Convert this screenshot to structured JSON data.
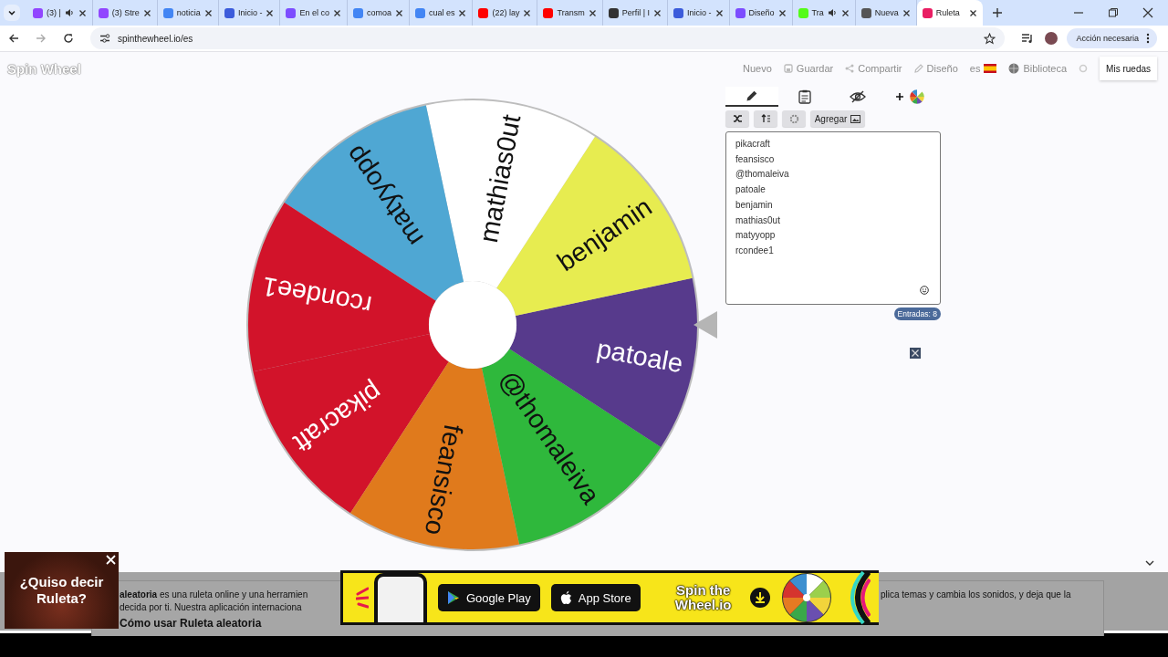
{
  "browser": {
    "tabs": [
      {
        "title": "(3) |",
        "color": "#9146ff",
        "audio": true,
        "selected": false
      },
      {
        "title": "(3) Stre",
        "color": "#9146ff",
        "audio": false,
        "selected": false
      },
      {
        "title": "noticia",
        "color": "#4285f4",
        "audio": false,
        "selected": false
      },
      {
        "title": "Inicio -",
        "color": "#3b5bdb",
        "audio": false,
        "selected": false
      },
      {
        "title": "En el co",
        "color": "#7c4dff",
        "audio": false,
        "selected": false
      },
      {
        "title": "comoa",
        "color": "#4285f4",
        "audio": false,
        "selected": false
      },
      {
        "title": "cual es",
        "color": "#4285f4",
        "audio": false,
        "selected": false
      },
      {
        "title": "(22) lay",
        "color": "#ff0000",
        "audio": false,
        "selected": false
      },
      {
        "title": "Transm",
        "color": "#ff0000",
        "audio": false,
        "selected": false
      },
      {
        "title": "Perfil | I",
        "color": "#333333",
        "audio": false,
        "selected": false
      },
      {
        "title": "Inicio -",
        "color": "#3b5bdb",
        "audio": false,
        "selected": false
      },
      {
        "title": "Diseño",
        "color": "#7c4dff",
        "audio": false,
        "selected": false
      },
      {
        "title": "Tra",
        "color": "#53fc18",
        "audio": true,
        "selected": false
      },
      {
        "title": "Nueva",
        "color": "#555555",
        "audio": false,
        "selected": false
      },
      {
        "title": "Ruleta",
        "color": "#e91e63",
        "audio": false,
        "selected": true
      }
    ],
    "url": "spinthewheel.io/es",
    "profile_button": "Acción necesaria"
  },
  "site": {
    "logo": "Spin Wheel",
    "nav": [
      {
        "label": "Nuevo",
        "kind": "plain"
      },
      {
        "label": "Guardar",
        "kind": "save"
      },
      {
        "label": "Compartir",
        "kind": "share"
      },
      {
        "label": "Diseño",
        "kind": "pencil"
      },
      {
        "label": "es",
        "kind": "flag"
      },
      {
        "label": "Biblioteca",
        "kind": "globe"
      }
    ],
    "my_wheels": "Mis ruedas"
  },
  "wheel": {
    "slices": [
      {
        "label": "pikacraft",
        "color": "#d2132a"
      },
      {
        "label": "feansisco",
        "color": "#e07a1c"
      },
      {
        "label": "@thomaleiva",
        "color": "#2fb83c"
      },
      {
        "label": "patoale",
        "color": "#573a8c"
      },
      {
        "label": "benjamin",
        "color": "#e7ec50"
      },
      {
        "label": "mathias0ut",
        "color": "#ffffff"
      },
      {
        "label": "matyyopp",
        "color": "#4fa7d3"
      },
      {
        "label": "rcondee1",
        "color": "#d2132a"
      }
    ]
  },
  "editor": {
    "tabs": [
      {
        "kind": "edit",
        "selected": true
      },
      {
        "kind": "results",
        "selected": false
      },
      {
        "kind": "hidden",
        "selected": false
      }
    ],
    "add_image": "Agregar",
    "entries": [
      "pikacraft",
      "feansisco",
      "@thomaleiva",
      "patoale",
      "benjamin",
      "mathias0ut",
      "matyyopp",
      "rcondee1"
    ],
    "count": "Entradas: 8"
  },
  "article": {
    "left_lines": [
      "**aleatoria** es una ruleta online y una herramien",
      "decida por ti. Nuestra aplicación internaciona"
    ],
    "right_lines": [
      "plica temas y cambia los sonidos, y deja que la"
    ],
    "heading": "Cómo usar Ruleta aleatoria"
  },
  "banner": {
    "google_play": "Google Play",
    "app_store": "App Store",
    "brand": "Spin the Wheel.io"
  },
  "popup": {
    "text": "¿Quiso decir Ruleta?"
  }
}
